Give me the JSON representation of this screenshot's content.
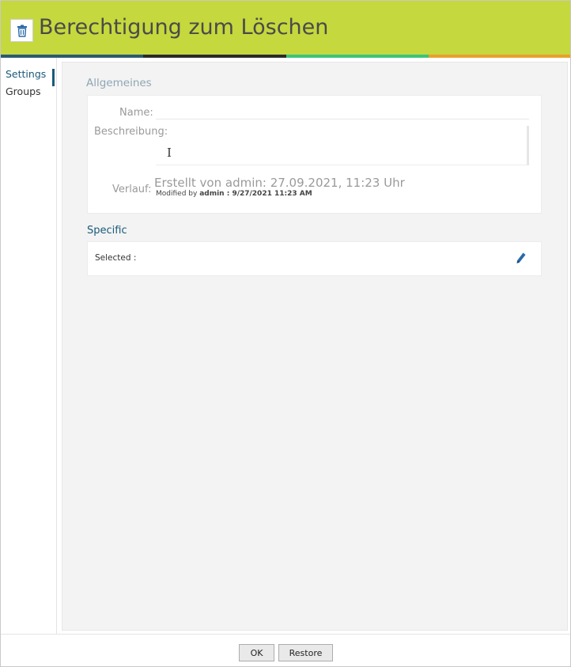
{
  "header": {
    "title": "Berechtigung zum Löschen",
    "icon": "trash-icon",
    "bg_color": "#c5d83d"
  },
  "stripe_colors": [
    "#2a5a73",
    "#2b2b2b",
    "#3cc47a",
    "#e8a12a"
  ],
  "sidebar": {
    "items": [
      {
        "label": "Settings",
        "active": true
      },
      {
        "label": "Groups",
        "active": false
      }
    ]
  },
  "general": {
    "section_title": "Allgemeines",
    "name_label": "Name:",
    "name_value": "",
    "description_label": "Beschreibung:",
    "description_value": "",
    "history_label": "Verlauf:",
    "created_text": "Erstellt von admin: 27.09.2021, 11:23 Uhr",
    "modified_prefix": "Modified by",
    "modified_detail": "admin : 9/27/2021 11:23 AM"
  },
  "specific": {
    "section_title": "Specific",
    "selected_label": "Selected :",
    "edit_icon": "pencil-icon"
  },
  "footer": {
    "ok_label": "OK",
    "restore_label": "Restore"
  }
}
